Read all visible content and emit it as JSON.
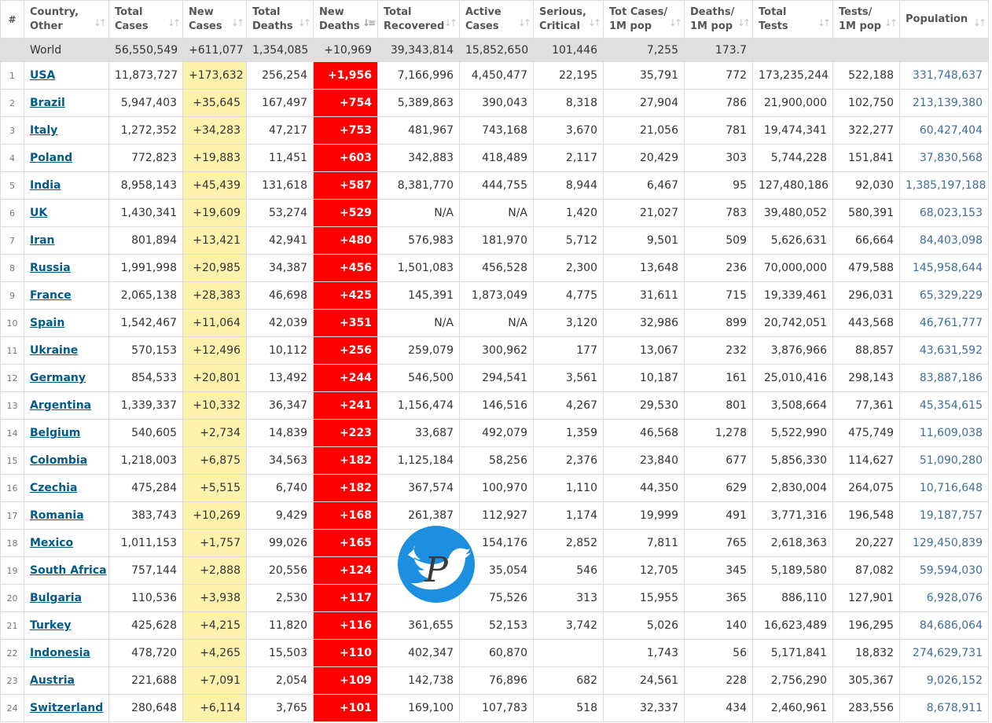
{
  "headers": [
    {
      "label": "#",
      "sortable": false
    },
    {
      "label": "Country,\nOther",
      "sortable": true
    },
    {
      "label": "Total\nCases",
      "sortable": true
    },
    {
      "label": "New\nCases",
      "sortable": true
    },
    {
      "label": "Total\nDeaths",
      "sortable": true
    },
    {
      "label": "New\nDeaths",
      "sortable": true,
      "active_sort": true
    },
    {
      "label": "Total\nRecovered",
      "sortable": true
    },
    {
      "label": "Active\nCases",
      "sortable": true
    },
    {
      "label": "Serious,\nCritical",
      "sortable": true
    },
    {
      "label": "Tot Cases/\n1M pop",
      "sortable": true
    },
    {
      "label": "Deaths/\n1M pop",
      "sortable": true
    },
    {
      "label": "Total\nTests",
      "sortable": true
    },
    {
      "label": "Tests/\n1M pop",
      "sortable": true
    },
    {
      "label": "Population",
      "sortable": true
    }
  ],
  "world": {
    "country": "World",
    "total_cases": "56,550,549",
    "new_cases": "+611,077",
    "total_deaths": "1,354,085",
    "new_deaths": "+10,969",
    "total_recovered": "39,343,814",
    "active_cases": "15,852,650",
    "serious": "101,446",
    "cases_per_m": "7,255",
    "deaths_per_m": "173.7",
    "total_tests": "",
    "tests_per_m": "",
    "population": ""
  },
  "rows": [
    {
      "n": "1",
      "country": "USA",
      "total_cases": "11,873,727",
      "new_cases": "+173,632",
      "total_deaths": "256,254",
      "new_deaths": "+1,956",
      "total_recovered": "7,166,996",
      "active_cases": "4,450,477",
      "serious": "22,195",
      "cases_per_m": "35,791",
      "deaths_per_m": "772",
      "total_tests": "173,235,244",
      "tests_per_m": "522,188",
      "population": "331,748,637"
    },
    {
      "n": "2",
      "country": "Brazil",
      "total_cases": "5,947,403",
      "new_cases": "+35,645",
      "total_deaths": "167,497",
      "new_deaths": "+754",
      "total_recovered": "5,389,863",
      "active_cases": "390,043",
      "serious": "8,318",
      "cases_per_m": "27,904",
      "deaths_per_m": "786",
      "total_tests": "21,900,000",
      "tests_per_m": "102,750",
      "population": "213,139,380"
    },
    {
      "n": "3",
      "country": "Italy",
      "total_cases": "1,272,352",
      "new_cases": "+34,283",
      "total_deaths": "47,217",
      "new_deaths": "+753",
      "total_recovered": "481,967",
      "active_cases": "743,168",
      "serious": "3,670",
      "cases_per_m": "21,056",
      "deaths_per_m": "781",
      "total_tests": "19,474,341",
      "tests_per_m": "322,277",
      "population": "60,427,404"
    },
    {
      "n": "4",
      "country": "Poland",
      "total_cases": "772,823",
      "new_cases": "+19,883",
      "total_deaths": "11,451",
      "new_deaths": "+603",
      "total_recovered": "342,883",
      "active_cases": "418,489",
      "serious": "2,117",
      "cases_per_m": "20,429",
      "deaths_per_m": "303",
      "total_tests": "5,744,228",
      "tests_per_m": "151,841",
      "population": "37,830,568"
    },
    {
      "n": "5",
      "country": "India",
      "total_cases": "8,958,143",
      "new_cases": "+45,439",
      "total_deaths": "131,618",
      "new_deaths": "+587",
      "total_recovered": "8,381,770",
      "active_cases": "444,755",
      "serious": "8,944",
      "cases_per_m": "6,467",
      "deaths_per_m": "95",
      "total_tests": "127,480,186",
      "tests_per_m": "92,030",
      "population": "1,385,197,188"
    },
    {
      "n": "6",
      "country": "UK",
      "total_cases": "1,430,341",
      "new_cases": "+19,609",
      "total_deaths": "53,274",
      "new_deaths": "+529",
      "total_recovered": "N/A",
      "active_cases": "N/A",
      "serious": "1,420",
      "cases_per_m": "21,027",
      "deaths_per_m": "783",
      "total_tests": "39,480,052",
      "tests_per_m": "580,391",
      "population": "68,023,153"
    },
    {
      "n": "7",
      "country": "Iran",
      "total_cases": "801,894",
      "new_cases": "+13,421",
      "total_deaths": "42,941",
      "new_deaths": "+480",
      "total_recovered": "576,983",
      "active_cases": "181,970",
      "serious": "5,712",
      "cases_per_m": "9,501",
      "deaths_per_m": "509",
      "total_tests": "5,626,631",
      "tests_per_m": "66,664",
      "population": "84,403,098"
    },
    {
      "n": "8",
      "country": "Russia",
      "total_cases": "1,991,998",
      "new_cases": "+20,985",
      "total_deaths": "34,387",
      "new_deaths": "+456",
      "total_recovered": "1,501,083",
      "active_cases": "456,528",
      "serious": "2,300",
      "cases_per_m": "13,648",
      "deaths_per_m": "236",
      "total_tests": "70,000,000",
      "tests_per_m": "479,588",
      "population": "145,958,644"
    },
    {
      "n": "9",
      "country": "France",
      "total_cases": "2,065,138",
      "new_cases": "+28,383",
      "total_deaths": "46,698",
      "new_deaths": "+425",
      "total_recovered": "145,391",
      "active_cases": "1,873,049",
      "serious": "4,775",
      "cases_per_m": "31,611",
      "deaths_per_m": "715",
      "total_tests": "19,339,461",
      "tests_per_m": "296,031",
      "population": "65,329,229"
    },
    {
      "n": "10",
      "country": "Spain",
      "total_cases": "1,542,467",
      "new_cases": "+11,064",
      "total_deaths": "42,039",
      "new_deaths": "+351",
      "total_recovered": "N/A",
      "active_cases": "N/A",
      "serious": "3,120",
      "cases_per_m": "32,986",
      "deaths_per_m": "899",
      "total_tests": "20,742,051",
      "tests_per_m": "443,568",
      "population": "46,761,777"
    },
    {
      "n": "11",
      "country": "Ukraine",
      "total_cases": "570,153",
      "new_cases": "+12,496",
      "total_deaths": "10,112",
      "new_deaths": "+256",
      "total_recovered": "259,079",
      "active_cases": "300,962",
      "serious": "177",
      "cases_per_m": "13,067",
      "deaths_per_m": "232",
      "total_tests": "3,876,966",
      "tests_per_m": "88,857",
      "population": "43,631,592"
    },
    {
      "n": "12",
      "country": "Germany",
      "total_cases": "854,533",
      "new_cases": "+20,801",
      "total_deaths": "13,492",
      "new_deaths": "+244",
      "total_recovered": "546,500",
      "active_cases": "294,541",
      "serious": "3,561",
      "cases_per_m": "10,187",
      "deaths_per_m": "161",
      "total_tests": "25,010,416",
      "tests_per_m": "298,143",
      "population": "83,887,186"
    },
    {
      "n": "13",
      "country": "Argentina",
      "total_cases": "1,339,337",
      "new_cases": "+10,332",
      "total_deaths": "36,347",
      "new_deaths": "+241",
      "total_recovered": "1,156,474",
      "active_cases": "146,516",
      "serious": "4,267",
      "cases_per_m": "29,530",
      "deaths_per_m": "801",
      "total_tests": "3,508,664",
      "tests_per_m": "77,361",
      "population": "45,354,615"
    },
    {
      "n": "14",
      "country": "Belgium",
      "total_cases": "540,605",
      "new_cases": "+2,734",
      "total_deaths": "14,839",
      "new_deaths": "+223",
      "total_recovered": "33,687",
      "active_cases": "492,079",
      "serious": "1,359",
      "cases_per_m": "46,568",
      "deaths_per_m": "1,278",
      "total_tests": "5,522,990",
      "tests_per_m": "475,749",
      "population": "11,609,038"
    },
    {
      "n": "15",
      "country": "Colombia",
      "total_cases": "1,218,003",
      "new_cases": "+6,875",
      "total_deaths": "34,563",
      "new_deaths": "+182",
      "total_recovered": "1,125,184",
      "active_cases": "58,256",
      "serious": "2,376",
      "cases_per_m": "23,840",
      "deaths_per_m": "677",
      "total_tests": "5,856,330",
      "tests_per_m": "114,627",
      "population": "51,090,280"
    },
    {
      "n": "16",
      "country": "Czechia",
      "total_cases": "475,284",
      "new_cases": "+5,515",
      "total_deaths": "6,740",
      "new_deaths": "+182",
      "total_recovered": "367,574",
      "active_cases": "100,970",
      "serious": "1,110",
      "cases_per_m": "44,350",
      "deaths_per_m": "629",
      "total_tests": "2,830,004",
      "tests_per_m": "264,075",
      "population": "10,716,648"
    },
    {
      "n": "17",
      "country": "Romania",
      "total_cases": "383,743",
      "new_cases": "+10,269",
      "total_deaths": "9,429",
      "new_deaths": "+168",
      "total_recovered": "261,387",
      "active_cases": "112,927",
      "serious": "1,174",
      "cases_per_m": "19,999",
      "deaths_per_m": "491",
      "total_tests": "3,771,316",
      "tests_per_m": "196,548",
      "population": "19,187,757"
    },
    {
      "n": "18",
      "country": "Mexico",
      "total_cases": "1,011,153",
      "new_cases": "+1,757",
      "total_deaths": "99,026",
      "new_deaths": "+165",
      "total_recovered": "",
      "active_cases": "154,176",
      "serious": "2,852",
      "cases_per_m": "7,811",
      "deaths_per_m": "765",
      "total_tests": "2,618,363",
      "tests_per_m": "20,227",
      "population": "129,450,839"
    },
    {
      "n": "19",
      "country": "South Africa",
      "total_cases": "757,144",
      "new_cases": "+2,888",
      "total_deaths": "20,556",
      "new_deaths": "+124",
      "total_recovered": "",
      "active_cases": "35,054",
      "serious": "546",
      "cases_per_m": "12,705",
      "deaths_per_m": "345",
      "total_tests": "5,189,580",
      "tests_per_m": "87,082",
      "population": "59,594,030"
    },
    {
      "n": "20",
      "country": "Bulgaria",
      "total_cases": "110,536",
      "new_cases": "+3,938",
      "total_deaths": "2,530",
      "new_deaths": "+117",
      "total_recovered": "",
      "active_cases": "75,526",
      "serious": "313",
      "cases_per_m": "15,955",
      "deaths_per_m": "365",
      "total_tests": "886,110",
      "tests_per_m": "127,901",
      "population": "6,928,076"
    },
    {
      "n": "21",
      "country": "Turkey",
      "total_cases": "425,628",
      "new_cases": "+4,215",
      "total_deaths": "11,820",
      "new_deaths": "+116",
      "total_recovered": "361,655",
      "active_cases": "52,153",
      "serious": "3,742",
      "cases_per_m": "5,026",
      "deaths_per_m": "140",
      "total_tests": "16,623,489",
      "tests_per_m": "196,295",
      "population": "84,686,064"
    },
    {
      "n": "22",
      "country": "Indonesia",
      "total_cases": "478,720",
      "new_cases": "+4,265",
      "total_deaths": "15,503",
      "new_deaths": "+110",
      "total_recovered": "402,347",
      "active_cases": "60,870",
      "serious": "",
      "cases_per_m": "1,743",
      "deaths_per_m": "56",
      "total_tests": "5,171,841",
      "tests_per_m": "18,832",
      "population": "274,629,731"
    },
    {
      "n": "23",
      "country": "Austria",
      "total_cases": "221,688",
      "new_cases": "+7,091",
      "total_deaths": "2,054",
      "new_deaths": "+109",
      "total_recovered": "142,738",
      "active_cases": "76,896",
      "serious": "682",
      "cases_per_m": "24,561",
      "deaths_per_m": "228",
      "total_tests": "2,756,290",
      "tests_per_m": "305,367",
      "population": "9,026,152"
    },
    {
      "n": "24",
      "country": "Switzerland",
      "total_cases": "280,648",
      "new_cases": "+6,114",
      "total_deaths": "3,765",
      "new_deaths": "+101",
      "total_recovered": "169,100",
      "active_cases": "107,783",
      "serious": "518",
      "cases_per_m": "32,337",
      "deaths_per_m": "434",
      "total_tests": "2,460,961",
      "tests_per_m": "283,556",
      "population": "8,678,911"
    }
  ],
  "watermark": {
    "letter": "P",
    "icon": "twitter-bird-icon",
    "color": "#1d8fe0"
  },
  "colors": {
    "new_cases_bg": "#fdf2ac",
    "new_deaths_bg": "#ff0000",
    "world_row_bg": "#dfdfdf",
    "country_link": "#005a8c",
    "population_text": "#3f6e9e"
  }
}
